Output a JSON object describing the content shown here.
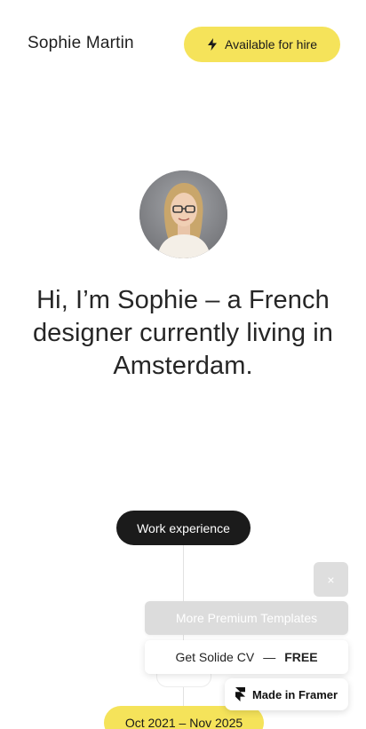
{
  "header": {
    "brand_name": "Sophie Martin",
    "hire_label": "Available for hire",
    "hire_icon": "lightning-bolt-icon"
  },
  "hero": {
    "avatar_alt": "Portrait of Sophie",
    "intro_text": "Hi, I’m Sophie – a French designer currently living in Amsterdam."
  },
  "timeline": {
    "section_label": "Work experience",
    "date_range": "Oct 2021 – Nov 2025"
  },
  "overlay": {
    "close_symbol": "×",
    "premium_label": "More Premium Templates",
    "solide_label": "Get Solide CV",
    "solide_dash": "—",
    "solide_free": "FREE",
    "framer_label": "Made in Framer",
    "framer_icon": "framer-logo-icon"
  },
  "colors": {
    "accent_yellow": "#f5e35a",
    "dark_pill": "#1b1b1b",
    "overlay_gray": "#dcdcdc"
  }
}
